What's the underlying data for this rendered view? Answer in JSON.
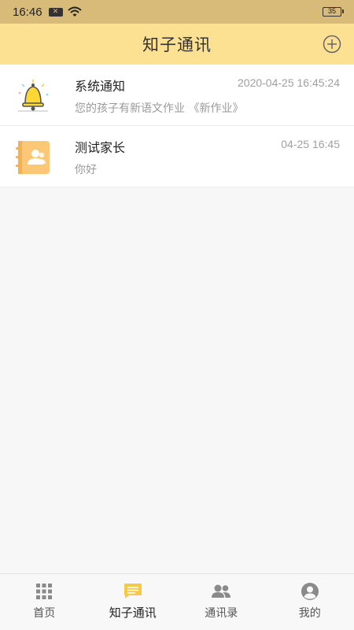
{
  "status_bar": {
    "time": "16:46",
    "battery": "35"
  },
  "header": {
    "title": "知子通讯"
  },
  "conversations": [
    {
      "name": "系统通知",
      "time": "2020-04-25 16:45:24",
      "preview": "您的孩子有新语文作业 《新作业》",
      "icon": "bell-icon"
    },
    {
      "name": "测试家长",
      "time": "04-25 16:45",
      "preview": "你好",
      "icon": "contact-book-icon"
    }
  ],
  "tabs": [
    {
      "label": "首页",
      "icon": "grid-icon",
      "active": false
    },
    {
      "label": "知子通讯",
      "icon": "chat-icon",
      "active": true
    },
    {
      "label": "通讯录",
      "icon": "contacts-icon",
      "active": false
    },
    {
      "label": "我的",
      "icon": "profile-icon",
      "active": false
    }
  ],
  "colors": {
    "header_bg": "#fde193",
    "status_bg": "#d8bb78",
    "accent": "#f7c94b"
  }
}
